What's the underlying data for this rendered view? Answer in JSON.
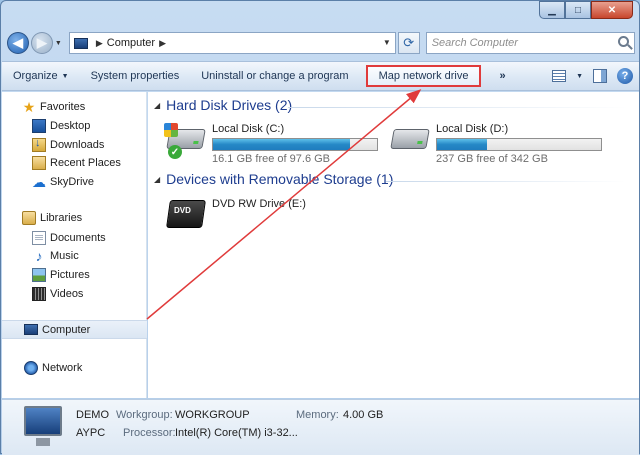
{
  "window": {
    "caption_buttons": [
      "minimize",
      "maximize",
      "close"
    ]
  },
  "address_bar": {
    "location": "Computer",
    "search_placeholder": "Search Computer"
  },
  "command_bar": {
    "organize": "Organize",
    "system_properties": "System properties",
    "uninstall": "Uninstall or change a program",
    "map_network_drive": "Map network drive",
    "more": "»"
  },
  "nav_pane": {
    "favorites": "Favorites",
    "favorites_items": [
      "Desktop",
      "Downloads",
      "Recent Places",
      "SkyDrive"
    ],
    "libraries": "Libraries",
    "libraries_items": [
      "Documents",
      "Music",
      "Pictures",
      "Videos"
    ],
    "computer": "Computer",
    "network": "Network"
  },
  "content": {
    "hdd_group": "Hard Disk Drives (2)",
    "removable_group": "Devices with Removable Storage (1)",
    "drives": [
      {
        "name": "Local Disk (C:)",
        "free": "16.1 GB free of 97.6 GB",
        "used_fraction": 0.835
      },
      {
        "name": "Local Disk (D:)",
        "free": "237 GB free of 342 GB",
        "used_fraction": 0.307
      }
    ],
    "dvd": {
      "name": "DVD RW Drive (E:)",
      "badge": "DVD"
    }
  },
  "details": {
    "name": "DEMO",
    "workgroup_label": "Workgroup:",
    "workgroup": "WORKGROUP",
    "memory_label": "Memory:",
    "memory": "4.00 GB",
    "host": "AYPC",
    "processor_label": "Processor:",
    "processor": "Intel(R) Core(TM) i3-32..."
  },
  "colors": {
    "annotation": "#e03b3b",
    "usage_bar": "#2588c6",
    "group_header": "#1e3d8f"
  }
}
